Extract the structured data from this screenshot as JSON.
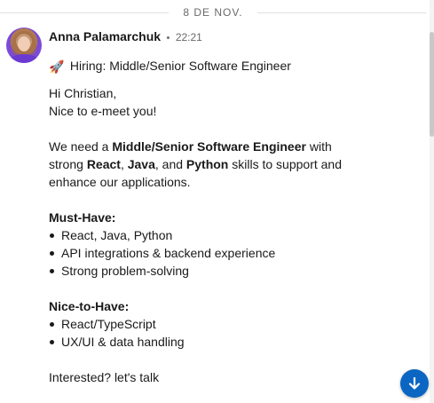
{
  "date_separator": "8 DE NOV.",
  "message": {
    "sender_name": "Anna Palamarchuk",
    "separator_dot": "•",
    "time": "22:21",
    "subject_emoji": "🚀",
    "subject": "Hiring: Middle/Senior Software Engineer",
    "greeting": "Hi Christian,",
    "intro": "Nice to e-meet you!",
    "need_prefix": "We need a ",
    "role": "Middle/Senior Software Engineer",
    "with_text": " with",
    "strong_text": "strong ",
    "skill_react": "React",
    "comma": ", ",
    "skill_java": "Java",
    "and_text": ", and ",
    "skill_python": "Python",
    "skills_suffix": " skills to support and",
    "enhance_text": "enhance our applications.",
    "must_have_heading": "Must-Have:",
    "must_have_items": [
      "React, Java, Python",
      "API integrations & backend experience",
      "Strong problem-solving"
    ],
    "nice_to_have_heading": "Nice-to-Have:",
    "nice_to_have_items": [
      "React/TypeScript",
      "UX/UI & data handling"
    ],
    "closing": "Interested? let's talk"
  },
  "icons": {
    "scroll_down": "arrow-down-icon",
    "subject": "rocket-icon"
  },
  "colors": {
    "accent": "#0a66c2",
    "separator_line": "#e0e0e0"
  }
}
